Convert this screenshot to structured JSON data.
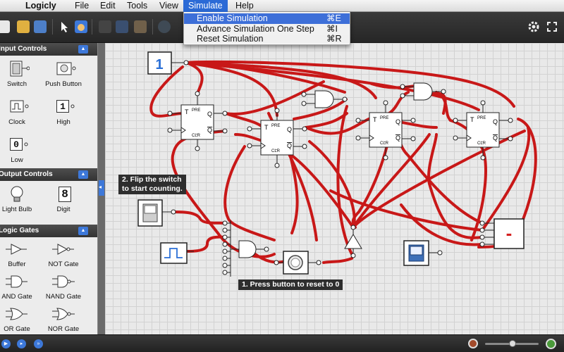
{
  "menubar": {
    "app_name": "Logicly",
    "items": [
      "File",
      "Edit",
      "Tools",
      "View",
      "Simulate",
      "Help"
    ]
  },
  "simulate_menu": {
    "items": [
      {
        "label": "Enable Simulation",
        "shortcut": "⌘E"
      },
      {
        "label": "Advance Simulation One Step",
        "shortcut": "⌘I"
      },
      {
        "label": "Reset Simulation",
        "shortcut": "⌘R"
      }
    ]
  },
  "sidebar": {
    "sections": [
      {
        "title": "Input Controls",
        "items": [
          "Switch",
          "Push Button",
          "Clock",
          "High",
          "Low"
        ]
      },
      {
        "title": "Output Controls",
        "items": [
          "Light Bulb",
          "Digit"
        ]
      },
      {
        "title": "Logic Gates",
        "items": [
          "Buffer",
          "NOT Gate",
          "AND Gate",
          "NAND Gate",
          "OR Gate",
          "NOR Gate"
        ]
      }
    ],
    "high_value": "1",
    "low_value": "0",
    "digit_value": "8"
  },
  "canvas": {
    "const_value": "1",
    "note_flip": "2. Flip the switch\nto start counting.",
    "note_press": "1. Press button to reset to 0",
    "flipflops": [
      {
        "pre": "PRE",
        "clr": "CLR",
        "t": "T",
        "q": "Q",
        "qbar": "Q"
      },
      {
        "pre": "PRE",
        "clr": "CLR",
        "t": "T",
        "q": "Q",
        "qbar": "Q"
      },
      {
        "pre": "PRE",
        "clr": "CLR",
        "t": "T",
        "q": "Q",
        "qbar": "Q"
      },
      {
        "pre": "PRE",
        "clr": "CLR",
        "t": "T",
        "q": "Q",
        "qbar": "Q"
      }
    ],
    "display_value": "-",
    "wire_color": "#d42020"
  },
  "colors": {
    "accent": "#3d78d9",
    "wire": "#d42020"
  }
}
